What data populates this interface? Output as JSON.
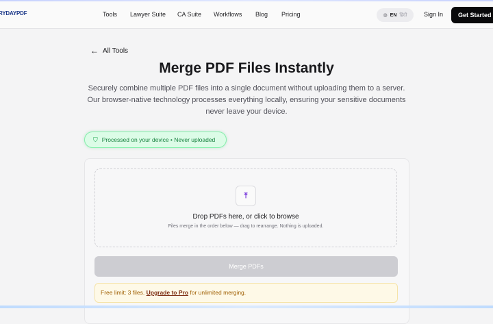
{
  "header": {
    "logo_text": "RYDAYPDF",
    "logo_mark": "▫",
    "nav": [
      "Tools",
      "Lawyer Suite",
      "CA Suite",
      "Workflows",
      "Blog",
      "Pricing"
    ],
    "lang_active": "EN",
    "lang_alt": "हिंदी",
    "signin": "Sign In",
    "cta": "Get Started"
  },
  "main": {
    "back_label": "All Tools",
    "title": "Merge PDF Files Instantly",
    "description": "Securely combine multiple PDF files into a single document without uploading them to a server. Our browser-native technology processes everything locally, ensuring your sensitive documents never leave your device.",
    "badge": "Processed on your device • Never uploaded",
    "drop_title": "Drop PDFs here, or click to browse",
    "drop_sub": "Files merge in the order below — drag to rearrange. Nothing is uploaded.",
    "merge_button": "Merge PDFs",
    "limit_prefix": "Free limit: 3 files.",
    "limit_link": "Upgrade to Pro",
    "limit_suffix": "for unlimited merging."
  },
  "colors": {
    "accent": "#09090b",
    "success": "#15803d",
    "warning": "#a16207",
    "upload_icon": "#6d28d9"
  },
  "icons": [
    "back-arrow-icon",
    "globe-icon",
    "shield-check-icon",
    "upload-icon"
  ]
}
